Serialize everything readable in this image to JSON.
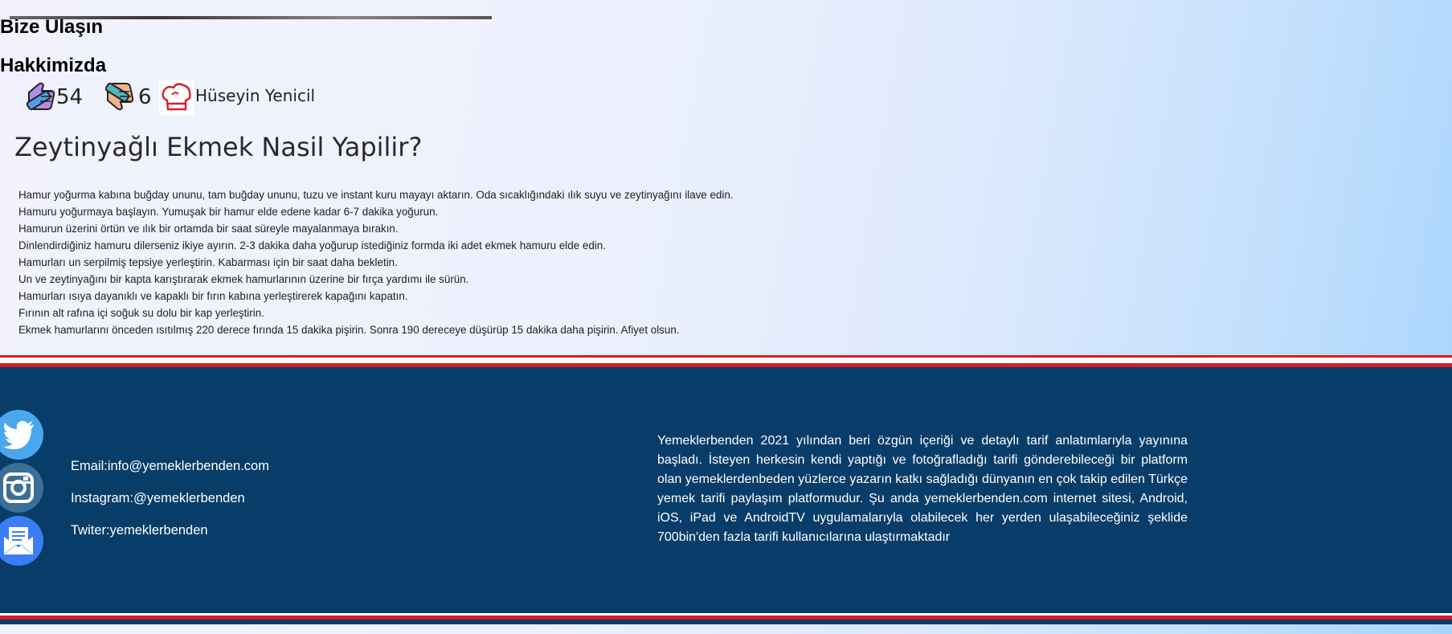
{
  "recipe": {
    "likes": "54",
    "dislikes": "6",
    "author": "Hüseyin Yenicil",
    "title": "Zeytinyağlı Ekmek Nasil Yapilir?",
    "steps": [
      "Hamur yoğurma kabına buğday ununu, tam buğday ununu, tuzu ve instant kuru mayayı aktarın. Oda sıcaklığındaki ılık suyu ve zeytinyağını ilave edin.",
      "Hamuru yoğurmaya başlayın. Yumuşak bir hamur elde edene kadar 6-7 dakika yoğurun.",
      "Hamurun üzerini örtün ve ılık bir ortamda bir saat süreyle mayalanmaya bırakın.",
      "Dinlendirdiğiniz hamuru dilerseniz ikiye ayırın. 2-3 dakika daha yoğurup istediğiniz formda iki adet ekmek hamuru elde edin.",
      "Hamurları un serpilmiş tepsiye yerleştirin. Kabarması için bir saat daha bekletin.",
      "Un ve zeytinyağını bir kapta karıştırarak ekmek hamurlarının üzerine bir fırça yardımı ile sürün.",
      "Hamurları ısıya dayanıklı ve kapaklı bir fırın kabına yerleştirerek kapağını kapatın.",
      "Fırının alt rafına içi soğuk su dolu bir kap yerleştirin.",
      "Ekmek hamurlarını önceden ısıtılmış 220 derece fırında 15 dakika pişirin. Sonra 190 dereceye düşürüp 15 dakika daha pişirin. Afiyet olsun."
    ],
    "icons": {
      "like": "thumbs-up-icon",
      "dislike": "thumbs-down-icon",
      "author": "chef-hat-icon"
    }
  },
  "footer": {
    "contact_title": "Bize Ulaşın",
    "email": "Email:info@yemeklerbenden.com",
    "instagram": "Instagram:@yemeklerbenden",
    "twitter": "Twiter:yemeklerbenden",
    "about_title": "Hakkimizda",
    "about_text": "Yemeklerbenden 2021 yılından beri özgün içeriği ve detaylı tarif anlatımlarıyla yayınına başladı. İsteyen herkesin kendi yaptığı ve fotoğrafladığı tarifi gönderebileceği bir platform olan yemeklerdenbeden yüzlerce yazarın katkı sağladığı dünyanın en çok takip edilen Türkçe yemek tarifi paylaşım platformudur. Şu anda yemeklerbenden.com internet sitesi, Android, iOS, iPad ve AndroidTV uygulamalarıyla olabilecek her yerden ulaşabileceğiniz şeklide 700bin'den fazla tarifi kullanıcılarına ulaştırmaktadır",
    "social_icons": [
      "twitter-icon",
      "instagram-icon",
      "mail-icon"
    ],
    "colors": {
      "background": "#083d69",
      "accent_line": "#d21d2b",
      "twitter": "#4aa7ee",
      "instagram": "#3a6f97",
      "mail": "#3a7ef5"
    }
  }
}
